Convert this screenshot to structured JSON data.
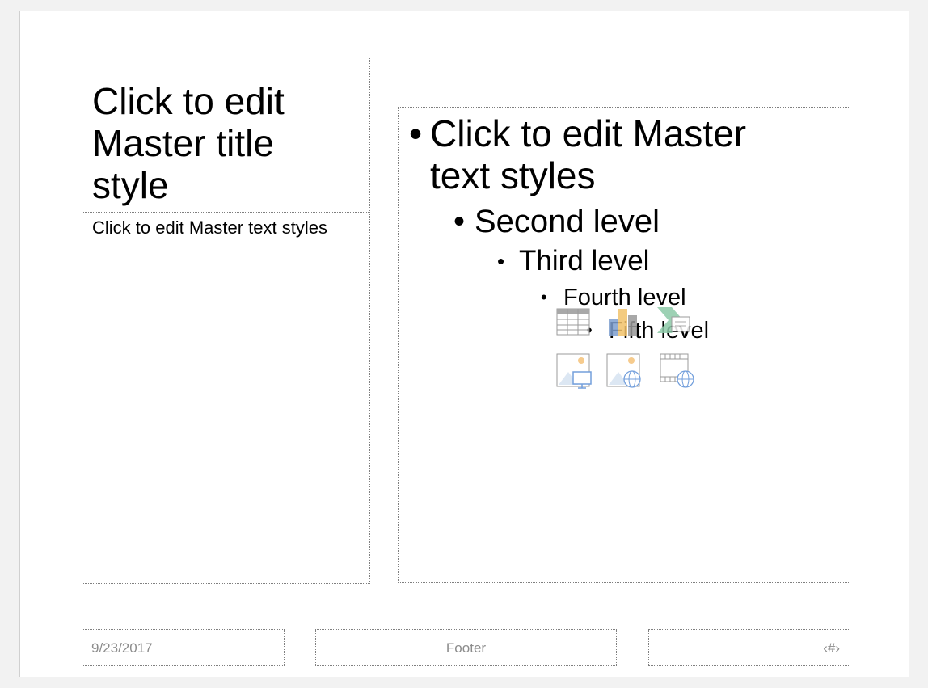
{
  "slide": {
    "title_placeholder": "Click to edit Master title style",
    "left_body_placeholder": "Click to edit Master text styles",
    "content_levels": {
      "level1": "Click to edit Master text styles",
      "level2": "Second level",
      "level3": "Third level",
      "level4": "Fourth level",
      "level5": "Fifth level",
      "bullet": "•"
    },
    "insert_icons": [
      "table-icon",
      "chart-icon",
      "smartart-icon",
      "pictures-icon",
      "online-pictures-icon",
      "online-video-icon"
    ],
    "footer": {
      "date": "9/23/2017",
      "text": "Footer",
      "slide_number": "‹#›"
    }
  },
  "colors": {
    "background": "#f2f2f2",
    "slide": "#ffffff",
    "placeholder_border": "#7f7f7f",
    "footer_text": "#8c8c8c"
  }
}
